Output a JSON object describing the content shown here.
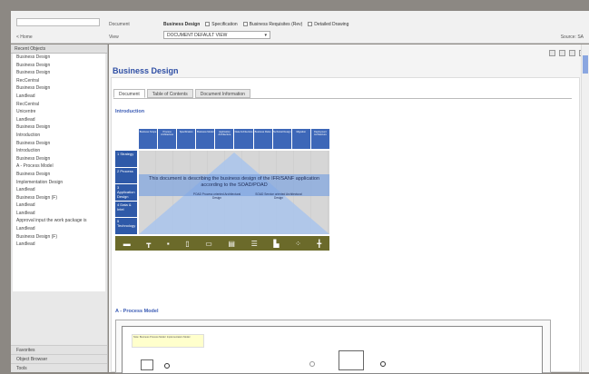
{
  "topbar": {
    "home": "< Home",
    "document_label": "Document",
    "view_label": "View",
    "document_name": "Business Design",
    "options": [
      "Specification",
      "Business Requisites (Rev)",
      "Detailed Drawing"
    ],
    "view_value": "DOCUMENT DEFAULT VIEW",
    "source": "Source: SA"
  },
  "sidebar": {
    "header": "Recent Objects",
    "items": [
      "Business Design",
      "Business Design",
      "Business Design",
      "RecCentral",
      "Business Design",
      "Landlead",
      "RecCentral",
      "Unicentre",
      "Landlead",
      "Business Design",
      "Introduction",
      "Business Design",
      "Introduction",
      "Business Design",
      "A - Process Model",
      "Business Design",
      "Implementation Design",
      "Landlead",
      "Business Design (F)",
      "Landlead",
      "Landlead",
      "Approval input the work package is",
      "Landlead",
      "Business Design (F)",
      "Landlead"
    ],
    "bottom": [
      "Favorites",
      "Object Browser",
      "Tools"
    ]
  },
  "main": {
    "title": "Business Design",
    "tabs": [
      "Document",
      "Table of Contents",
      "Document Information"
    ],
    "section_intro": "Introduction",
    "section_process": "A - Process Model",
    "diagram": {
      "header_cols": [
        "Business Scope",
        "Process Architecture",
        "Specification",
        "Business Model",
        "Application Architecture",
        "Data Architecture",
        "Business Rules",
        "Technical Design",
        "Migration",
        "Deployment Architecture"
      ],
      "side_rows": [
        "1 Strategy",
        "2 Process",
        "3 Application Design",
        "4 Data & Intel",
        "5 Technology"
      ],
      "main_text": "This document is describing the business design of the IFR/SANF application according to the SOAD/POAD",
      "sub_left": "POAD Process oriented Architectural Design",
      "sub_right": "SOAD Service oriented Architectural Design",
      "icons": [
        "workflow",
        "org",
        "number",
        "document",
        "ticket",
        "window",
        "list",
        "tree",
        "timeline",
        "gantt"
      ]
    },
    "process_note": "Note: Business Process Model: Implementation Model"
  }
}
